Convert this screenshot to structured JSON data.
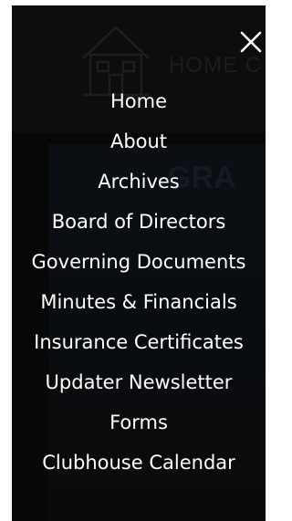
{
  "background": {
    "header_text": "HOME C",
    "banner_text": "GRA"
  },
  "close_icon": "close-icon",
  "menu": {
    "items": [
      {
        "label": "Home"
      },
      {
        "label": "About"
      },
      {
        "label": "Archives"
      },
      {
        "label": "Board of Directors"
      },
      {
        "label": "Governing Documents"
      },
      {
        "label": "Minutes & Financials"
      },
      {
        "label": "Insurance Certificates"
      },
      {
        "label": "Updater Newsletter"
      },
      {
        "label": "Forms"
      },
      {
        "label": "Clubhouse Calendar"
      }
    ]
  },
  "colors": {
    "overlay": "#0b0b0b",
    "menu_text": "#ffffff"
  }
}
